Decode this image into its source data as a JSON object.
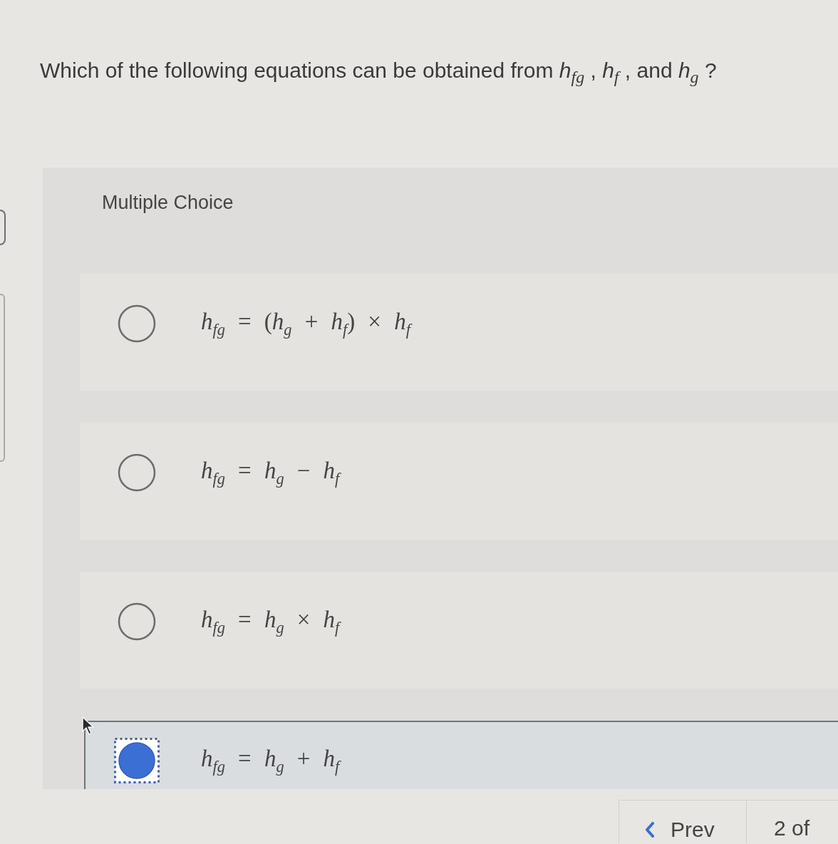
{
  "question": "Which of the following equations can be obtained from *h*$_{fg}$ , *h*$_{f}$ , and *h*$_{g}$ ?",
  "section_label": "Multiple Choice",
  "options": [
    {
      "equation": "*h*$_{fg}$ = (*h*$_{g}$ + *h*$_{f}$) × *h*$_{f}$",
      "selected": false
    },
    {
      "equation": "*h*$_{fg}$ = *h*$_{g}$ − *h*$_{f}$",
      "selected": false
    },
    {
      "equation": "*h*$_{fg}$ = *h*$_{g}$ × *h*$_{f}$",
      "selected": false
    },
    {
      "equation": "*h*$_{fg}$ = *h*$_{g}$ + *h*$_{f}$",
      "selected": true
    }
  ],
  "navigation": {
    "prev_button": "Prev",
    "page_indicator": "2 of"
  }
}
